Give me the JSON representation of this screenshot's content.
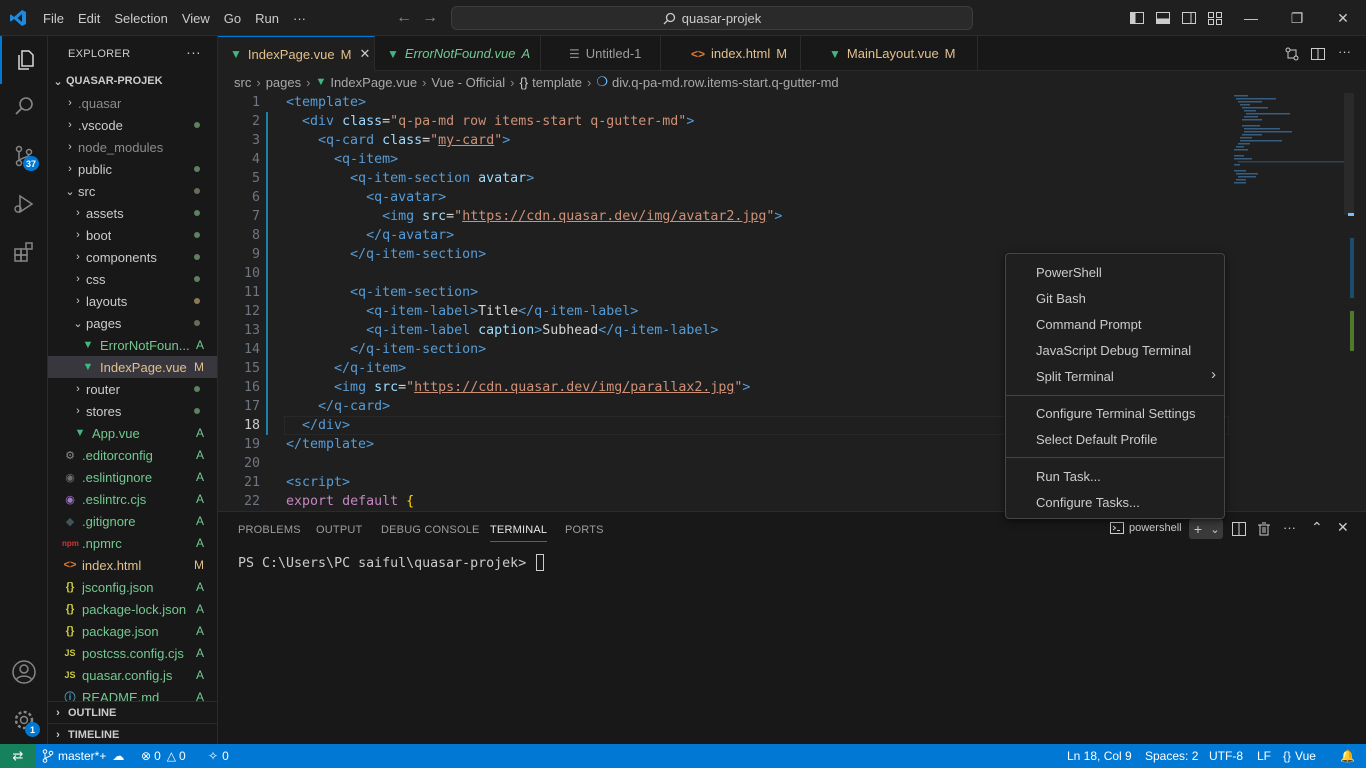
{
  "titlebar": {
    "menu": [
      "File",
      "Edit",
      "Selection",
      "View",
      "Go",
      "Run",
      "···"
    ],
    "search": "quasar-projek"
  },
  "activity": {
    "scm_badge": "37",
    "settings_badge": "1"
  },
  "explorer": {
    "title": "EXPLORER",
    "root": "QUASAR-PROJEK",
    "items": [
      {
        "label": ".quasar",
        "status": ""
      },
      {
        "label": ".vscode",
        "status": ""
      },
      {
        "label": "node_modules",
        "status": ""
      },
      {
        "label": "public",
        "status": ""
      },
      {
        "label": "src",
        "status": ""
      },
      {
        "label": "assets",
        "status": ""
      },
      {
        "label": "boot",
        "status": ""
      },
      {
        "label": "components",
        "status": ""
      },
      {
        "label": "css",
        "status": ""
      },
      {
        "label": "layouts",
        "status": ""
      },
      {
        "label": "pages",
        "status": ""
      },
      {
        "label": "ErrorNotFoun...",
        "status": "A"
      },
      {
        "label": "IndexPage.vue",
        "status": "M"
      },
      {
        "label": "router",
        "status": ""
      },
      {
        "label": "stores",
        "status": ""
      },
      {
        "label": "App.vue",
        "status": "A"
      },
      {
        "label": ".editorconfig",
        "status": "A"
      },
      {
        "label": ".eslintignore",
        "status": "A"
      },
      {
        "label": ".eslintrc.cjs",
        "status": "A"
      },
      {
        "label": ".gitignore",
        "status": "A"
      },
      {
        "label": ".npmrc",
        "status": "A"
      },
      {
        "label": "index.html",
        "status": "M"
      },
      {
        "label": "jsconfig.json",
        "status": "A"
      },
      {
        "label": "package-lock.json",
        "status": "A"
      },
      {
        "label": "package.json",
        "status": "A"
      },
      {
        "label": "postcss.config.cjs",
        "status": "A"
      },
      {
        "label": "quasar.config.js",
        "status": "A"
      },
      {
        "label": "README.md",
        "status": "A"
      }
    ],
    "outline": "OUTLINE",
    "timeline": "TIMELINE"
  },
  "tabs": [
    {
      "label": "IndexPage.vue",
      "status": "M"
    },
    {
      "label": "ErrorNotFound.vue",
      "status": "A"
    },
    {
      "label": "Untitled-1",
      "status": ""
    },
    {
      "label": "index.html",
      "status": "M"
    },
    {
      "label": "MainLayout.vue",
      "status": "M"
    }
  ],
  "breadcrumb": [
    "src",
    "pages",
    "IndexPage.vue",
    "Vue - Official",
    "template",
    "div.q-pa-md.row.items-start.q-gutter-md"
  ],
  "editor": {
    "line_numbers": [
      "1",
      "2",
      "3",
      "4",
      "5",
      "6",
      "7",
      "8",
      "9",
      "10",
      "11",
      "12",
      "13",
      "14",
      "15",
      "16",
      "17",
      "18",
      "19",
      "20",
      "21",
      "22"
    ]
  },
  "panel": {
    "tabs": [
      "PROBLEMS",
      "OUTPUT",
      "DEBUG CONSOLE",
      "TERMINAL",
      "PORTS"
    ],
    "terminal_name": "powershell",
    "prompt": "PS C:\\Users\\PC saiful\\quasar-projek> "
  },
  "context_menu": {
    "group1": [
      "PowerShell",
      "Git Bash",
      "Command Prompt",
      "JavaScript Debug Terminal",
      "Split Terminal"
    ],
    "group2": [
      "Configure Terminal Settings",
      "Select Default Profile"
    ],
    "group3": [
      "Run Task...",
      "Configure Tasks..."
    ]
  },
  "statusbar": {
    "branch": "master*+",
    "errors": "0",
    "warnings": "0",
    "ports": "0",
    "position": "Ln 18, Col 9",
    "spaces": "Spaces: 2",
    "encoding": "UTF-8",
    "eol": "LF",
    "language": "Vue"
  },
  "colors": {
    "accent": "#0078d4",
    "modified": "#e2c08d",
    "added": "#73c991",
    "remote": "#16825d"
  }
}
